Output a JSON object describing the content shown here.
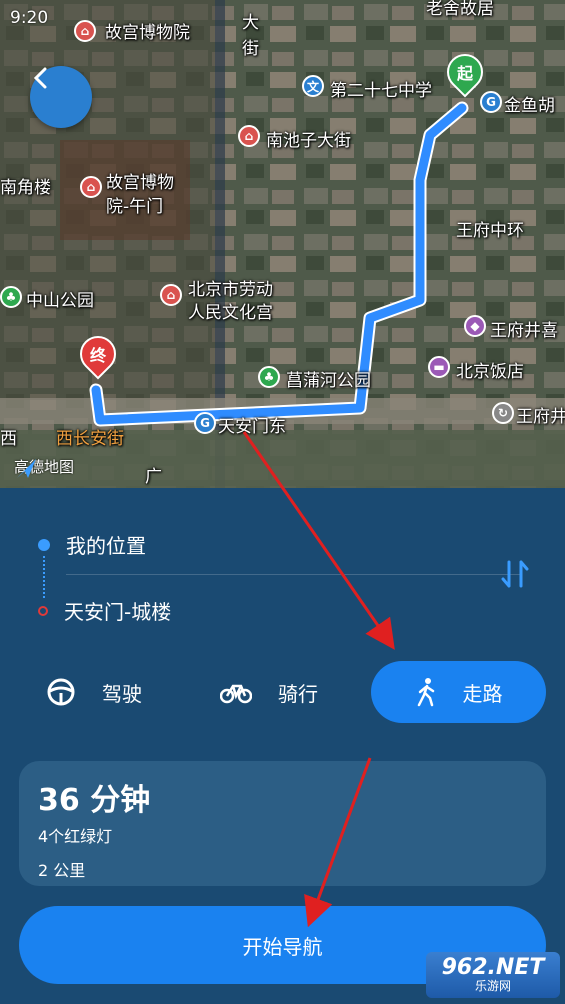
{
  "status": {
    "time": "9:20"
  },
  "map": {
    "labels": [
      {
        "text": "故宫博物院"
      },
      {
        "text": "大"
      },
      {
        "text": "街"
      },
      {
        "text": "老舍故居"
      },
      {
        "text": "第二十七中学"
      },
      {
        "text": "金鱼胡"
      },
      {
        "text": "南池子大街"
      },
      {
        "text": "南角楼"
      },
      {
        "text": "故宫博物"
      },
      {
        "text": "院-午门"
      },
      {
        "text": "王府中环"
      },
      {
        "text": "北京市劳动"
      },
      {
        "text": "人民文化宫"
      },
      {
        "text": "中山公园"
      },
      {
        "text": "王府井喜"
      },
      {
        "text": "北京饭店"
      },
      {
        "text": "菖蒲河公园"
      },
      {
        "text": "王府井"
      },
      {
        "text": "天安门东"
      },
      {
        "text": "西长安街"
      },
      {
        "text": "西"
      },
      {
        "text": "广"
      }
    ],
    "start_pin": "起",
    "end_pin": "终",
    "logo": "高德地图",
    "poi_subway": "G",
    "poi_school": "文"
  },
  "route": {
    "from": "我的位置",
    "to": "天安门-城楼"
  },
  "modes": [
    {
      "label": "驾驶",
      "icon": "steering-wheel-icon",
      "active": false
    },
    {
      "label": "骑行",
      "icon": "bicycle-icon",
      "active": false
    },
    {
      "label": "走路",
      "icon": "walking-icon",
      "active": true
    }
  ],
  "summary": {
    "eta": "36 分钟",
    "traffic_lights": "4个红绿灯",
    "distance": "2 公里"
  },
  "start_button": "开始导航",
  "watermark": {
    "big": "962.NET",
    "small": "乐游网"
  },
  "colors": {
    "accent": "#1a82f0",
    "panel": "#1a4a72",
    "card": "#2c5e85",
    "route": "#2f8cff"
  }
}
